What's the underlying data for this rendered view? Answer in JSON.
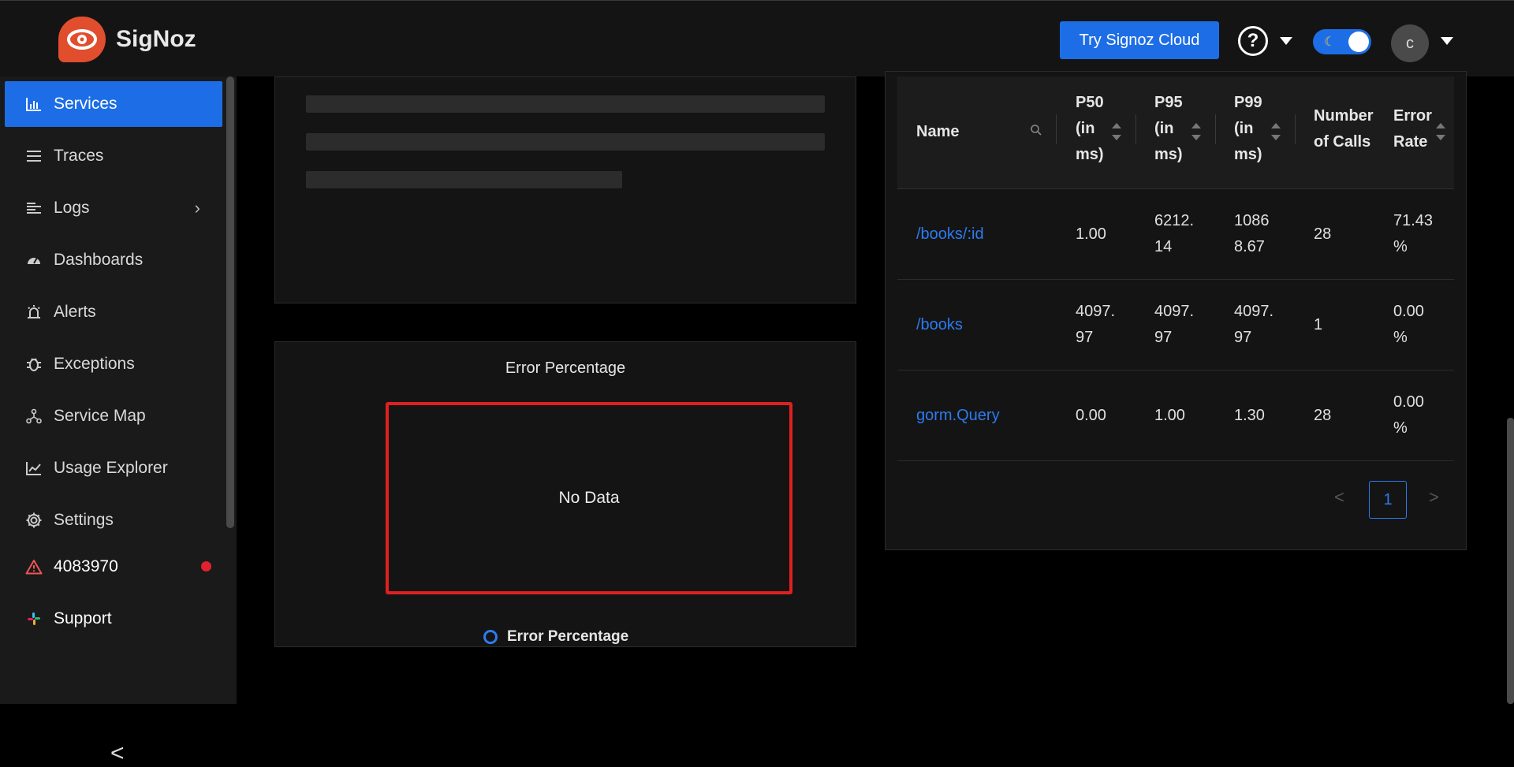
{
  "header": {
    "brand": "SigNoz",
    "cloud_button": "Try Signoz Cloud",
    "help_glyph": "?",
    "avatar_initial": "c"
  },
  "sidebar": {
    "items": [
      {
        "label": "Services",
        "icon": "bar-chart-icon",
        "active": true
      },
      {
        "label": "Traces",
        "icon": "menu-lines-icon"
      },
      {
        "label": "Logs",
        "icon": "align-left-icon"
      },
      {
        "label": "Dashboards",
        "icon": "dashboard-gauge-icon"
      },
      {
        "label": "Alerts",
        "icon": "alarm-icon"
      },
      {
        "label": "Exceptions",
        "icon": "bug-icon"
      },
      {
        "label": "Service Map",
        "icon": "deployment-unit-icon"
      },
      {
        "label": "Usage Explorer",
        "icon": "line-chart-icon"
      },
      {
        "label": "Settings",
        "icon": "gear-icon"
      },
      {
        "label": "4083970",
        "icon": "warning-icon"
      },
      {
        "label": "Support",
        "icon": "slack-icon"
      }
    ],
    "collapse_glyph": "<"
  },
  "error_panel": {
    "title": "Error Percentage",
    "no_data": "No Data",
    "legend_label": "Error Percentage"
  },
  "table": {
    "headers": {
      "name": "Name",
      "p50_line1": "P50",
      "p50_line2": "(in",
      "p50_line3": "ms)",
      "p95_line1": "P95",
      "p95_line2": "(in",
      "p95_line3": "ms)",
      "p99_line1": "P99",
      "p99_line2": "(in",
      "p99_line3": "ms)",
      "calls_line1": "Number",
      "calls_line2": "of Calls",
      "error_line1": "Error",
      "error_line2": "Rate"
    },
    "rows": [
      {
        "name": "/books/:id",
        "p50": "1.00",
        "p95_a": "6212.",
        "p95_b": "14",
        "p99_a": "1086",
        "p99_b": "8.67",
        "calls": "28",
        "err_a": "71.43",
        "err_b": "%"
      },
      {
        "name": "/books",
        "p50_a": "4097.",
        "p50_b": "97",
        "p95_a": "4097.",
        "p95_b": "97",
        "p99_a": "4097.",
        "p99_b": "97",
        "calls": "1",
        "err_a": "0.00",
        "err_b": "%"
      },
      {
        "name": "gorm.Query",
        "p50": "0.00",
        "p95": "1.00",
        "p99": "1.30",
        "calls": "28",
        "err_a": "0.00",
        "err_b": "%"
      }
    ],
    "pagination": {
      "current": "1",
      "prev": "<",
      "next": ">"
    }
  },
  "colors": {
    "accent": "#1d6ee6",
    "link": "#2d7bf0",
    "alert_red": "#e02020",
    "brand_orange": "#e04e2e"
  }
}
